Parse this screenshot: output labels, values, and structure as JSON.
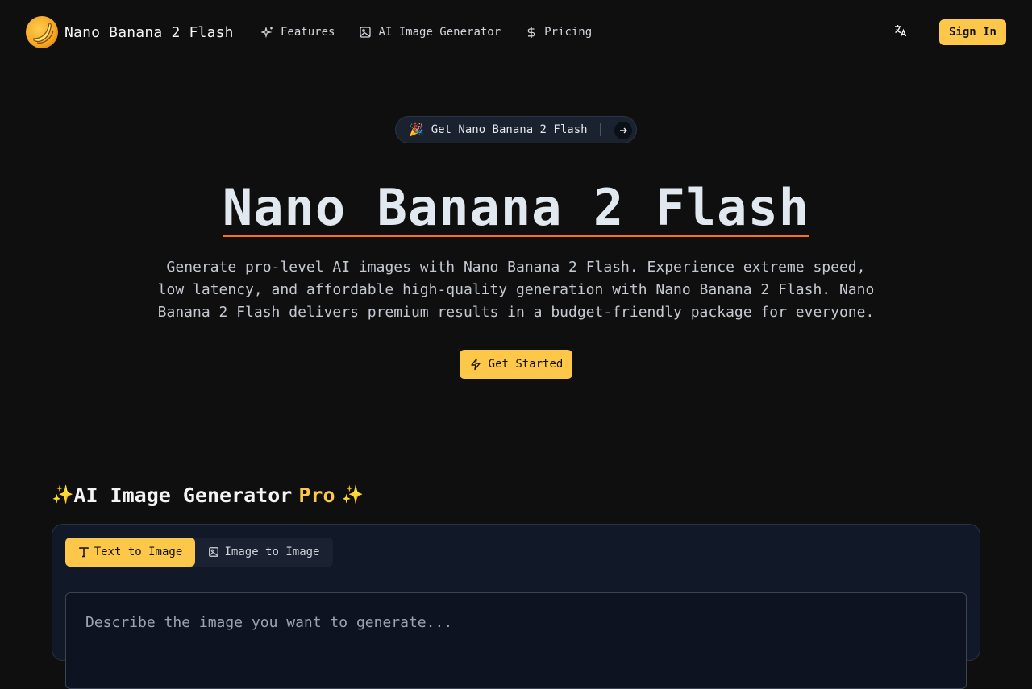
{
  "header": {
    "brand_name": "Nano Banana 2 Flash",
    "nav": [
      {
        "label": "Features",
        "icon": "sparkles-icon"
      },
      {
        "label": "AI Image Generator",
        "icon": "image-icon"
      },
      {
        "label": "Pricing",
        "icon": "dollar-icon"
      }
    ],
    "language_icon": "translate-icon",
    "signin_label": "Sign In"
  },
  "hero": {
    "announce_emoji": "🎉",
    "announce_label": "Get Nano Banana 2 Flash",
    "title": "Nano Banana 2 Flash",
    "description": "Generate pro-level AI images with Nano Banana 2 Flash. Experience extreme speed, low latency, and affordable high-quality generation with Nano Banana 2 Flash. Nano Banana 2 Flash delivers premium results in a budget-friendly package for everyone.",
    "cta_label": "Get Started"
  },
  "generator": {
    "heading_spark_left": "✨",
    "heading": "AI Image Generator",
    "heading_pro": "Pro",
    "heading_spark_right": "✨",
    "tabs": [
      {
        "label": "Text to Image",
        "active": true
      },
      {
        "label": "Image to Image",
        "active": false
      }
    ],
    "prompt_placeholder": "Describe the image you want to generate..."
  },
  "colors": {
    "accent": "#fdc84a",
    "background": "#0f0f10",
    "title_underline": "#f97316"
  }
}
